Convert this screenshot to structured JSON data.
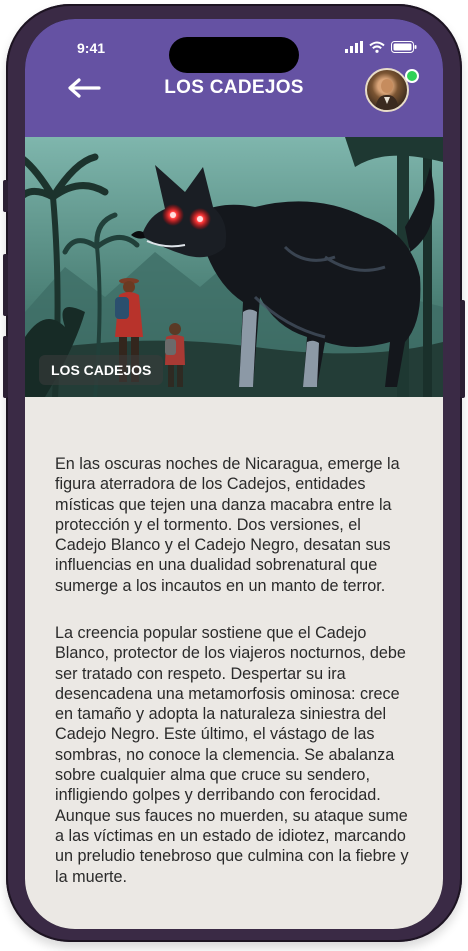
{
  "status_bar": {
    "time": "9:41"
  },
  "header": {
    "title": "LOS CADEJOS"
  },
  "hero": {
    "caption": "LOS CADEJOS"
  },
  "article": {
    "paragraphs": [
      "En las oscuras noches de Nicaragua, emerge la figura aterradora de los Cadejos, entidades místicas que tejen una danza macabra entre la protección y el tormento. Dos versiones, el Cadejo Blanco y el Cadejo Negro, desatan sus influencias en una dualidad sobrenatural que sumerge a los incautos en un manto de terror.",
      "La creencia popular sostiene que el Cadejo Blanco, protector de los viajeros nocturnos, debe ser tratado con respeto. Despertar su ira desencadena una metamorfosis ominosa: crece en tamaño y adopta la naturaleza siniestra del Cadejo Negro. Este último, el vástago de las sombras, no conoce la clemencia. Se abalanza sobre cualquier alma que cruce su sendero, infligiendo golpes y derribando con ferocidad. Aunque sus fauces no muerden, su ataque sume a las víctimas en un estado de idiotez, marcando un preludio tenebroso que culmina con la fiebre y la muerte."
    ]
  },
  "colors": {
    "header_bg": "#6552a3",
    "content_bg": "#ebe8e4",
    "online": "#31d158"
  },
  "icons": [
    "back-arrow-icon",
    "signal-icon",
    "wifi-icon",
    "battery-icon"
  ]
}
